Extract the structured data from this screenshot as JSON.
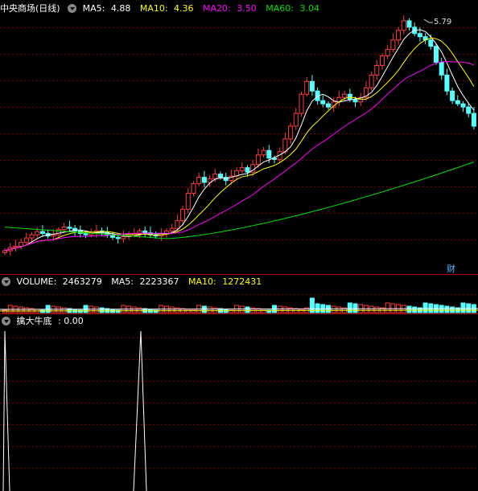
{
  "main": {
    "stock_name": "中央商场(日线)",
    "ma5": {
      "label": "MA5:",
      "value": "4.88",
      "color": "#ffffff"
    },
    "ma10": {
      "label": "MA10:",
      "value": "4.36",
      "color": "#ffff00"
    },
    "ma20": {
      "label": "MA20:",
      "value": "3.50",
      "color": "#ff00ff"
    },
    "ma60": {
      "label": "MA60:",
      "value": "3.04",
      "color": "#00e000"
    },
    "high_label": "5.79",
    "cai_label": "财"
  },
  "volume": {
    "label": "VOLUME:",
    "value": "2463279",
    "ma5": {
      "label": "MA5:",
      "value": "2223367"
    },
    "ma10": {
      "label": "MA10:",
      "value": "1272431"
    }
  },
  "indicator": {
    "name": "擒大牛底",
    "value": ": 0.00"
  },
  "colors": {
    "up": "#ff3c3c",
    "down": "#54ffff",
    "grid": "#7a0000"
  }
}
